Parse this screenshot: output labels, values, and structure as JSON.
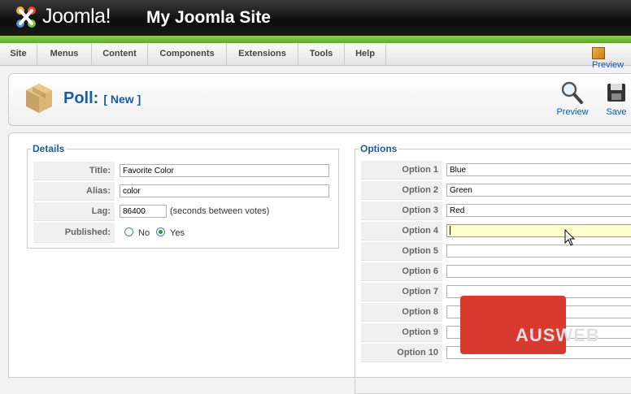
{
  "header": {
    "brand": "Joomla!",
    "site_title": "My Joomla Site"
  },
  "menu": {
    "items": [
      "Site",
      "Menus",
      "Content",
      "Components",
      "Extensions",
      "Tools",
      "Help"
    ],
    "preview_label": "Preview"
  },
  "toolbar": {
    "title": "Poll:",
    "subtitle": "[ New ]",
    "preview_label": "Preview",
    "save_label": "Save"
  },
  "details": {
    "legend": "Details",
    "title_label": "Title:",
    "title_value": "Favorite Color",
    "alias_label": "Alias:",
    "alias_value": "color",
    "lag_label": "Lag:",
    "lag_value": "86400",
    "lag_hint": "(seconds between votes)",
    "published_label": "Published:",
    "no_label": "No",
    "yes_label": "Yes",
    "published_selected": "Yes"
  },
  "options": {
    "legend": "Options",
    "rows": [
      {
        "label": "Option 1",
        "value": "Blue"
      },
      {
        "label": "Option 2",
        "value": "Green"
      },
      {
        "label": "Option 3",
        "value": "Red"
      },
      {
        "label": "Option 4",
        "value": ""
      },
      {
        "label": "Option 5",
        "value": ""
      },
      {
        "label": "Option 6",
        "value": ""
      },
      {
        "label": "Option 7",
        "value": ""
      },
      {
        "label": "Option 8",
        "value": ""
      },
      {
        "label": "Option 9",
        "value": ""
      },
      {
        "label": "Option 10",
        "value": ""
      }
    ]
  },
  "watermark": {
    "text": "AUSWEB"
  },
  "colors": {
    "accent_green": "#6cbf35",
    "title_blue": "#1b5aa4",
    "focus_field": "#ffffcc"
  }
}
